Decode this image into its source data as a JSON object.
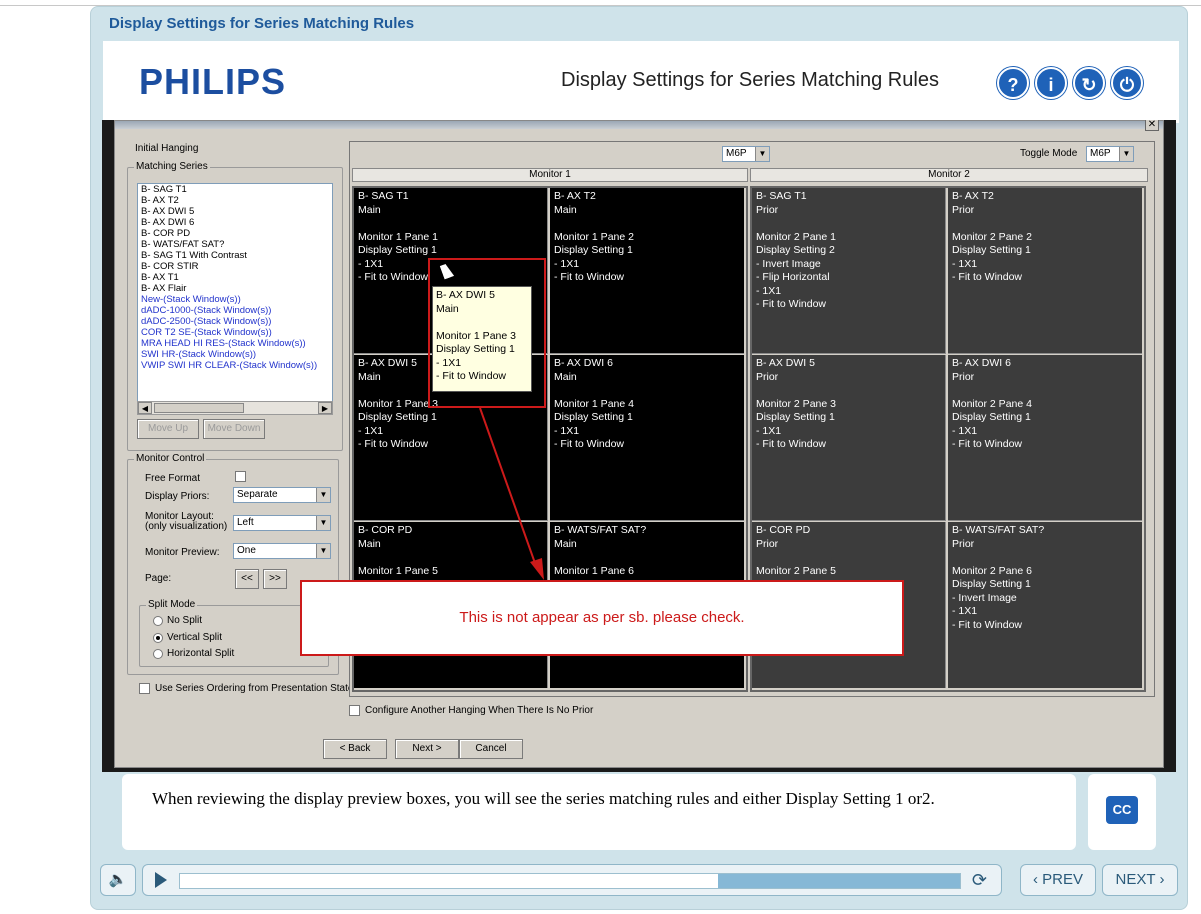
{
  "window_title": "Display Settings for Series Matching Rules",
  "header": {
    "logo": "PHILIPS",
    "title": "Display Settings for Series Matching Rules",
    "buttons": [
      {
        "icon": "help-icon",
        "glyph": "?"
      },
      {
        "icon": "info-icon",
        "glyph": "i"
      },
      {
        "icon": "replay-icon",
        "glyph": "↻"
      },
      {
        "icon": "power-icon",
        "glyph": "⏻"
      }
    ]
  },
  "dialog": {
    "initial_hanging_label": "Initial Hanging",
    "matching_series_label": "Matching Series",
    "series": [
      {
        "text": "B- SAG T1",
        "link": false
      },
      {
        "text": "B- AX T2",
        "link": false
      },
      {
        "text": "B- AX DWI 5",
        "link": false
      },
      {
        "text": "B- AX DWI 6",
        "link": false
      },
      {
        "text": "B- COR PD",
        "link": false
      },
      {
        "text": "B- WATS/FAT SAT?",
        "link": false
      },
      {
        "text": "B- SAG T1 With Contrast",
        "link": false
      },
      {
        "text": "B- COR STIR",
        "link": false
      },
      {
        "text": "B- AX T1",
        "link": false
      },
      {
        "text": "B- AX Flair",
        "link": false
      },
      {
        "text": "New-(Stack Window(s))",
        "link": true
      },
      {
        "text": "dADC-1000-(Stack Window(s))",
        "link": true
      },
      {
        "text": "dADC-2500-(Stack Window(s))",
        "link": true
      },
      {
        "text": "COR T2 SE-(Stack Window(s))",
        "link": true
      },
      {
        "text": "MRA HEAD HI RES-(Stack Window(s))",
        "link": true
      },
      {
        "text": "SWI HR-(Stack Window(s))",
        "link": true
      },
      {
        "text": "VWIP SWI HR CLEAR-(Stack Window(s))",
        "link": true
      }
    ],
    "move_up": "Move Up",
    "move_down": "Move Down",
    "monitor_control_label": "Monitor Control",
    "free_format_label": "Free Format",
    "display_priors_label": "Display Priors:",
    "display_priors_value": "Separate",
    "monitor_layout_label": "Monitor Layout:",
    "monitor_layout_sub": "(only visualization)",
    "monitor_layout_value": "Left",
    "monitor_preview_label": "Monitor Preview:",
    "monitor_preview_value": "One",
    "page_label": "Page:",
    "page_prev": "<<",
    "page_next": ">>",
    "split_mode_label": "Split Mode",
    "split_options": [
      "No Split",
      "Vertical Split",
      "Horizontal Split"
    ],
    "split_selected": "Vertical Split",
    "use_series_ordering": "Use Series Ordering from Presentation State",
    "top_combo_value": "M6P",
    "toggle_mode_label": "Toggle Mode",
    "toggle_mode_value": "M6P",
    "monitor1_label": "Monitor 1",
    "monitor2_label": "Monitor 2",
    "configure_another": "Configure Another Hanging When There Is No Prior",
    "back": "< Back",
    "next": "Next >",
    "cancel": "Cancel"
  },
  "monitor1_panes": [
    "B- SAG T1\nMain\n\nMonitor 1 Pane 1\nDisplay Setting 1\n- 1X1\n- Fit to Window",
    "B- AX T2\nMain\n\nMonitor 1 Pane 2\nDisplay Setting 1\n- 1X1\n- Fit to Window",
    "B- AX DWI 5\nMain\n\nMonitor 1 Pane 3\nDisplay Setting 1\n- 1X1\n- Fit to Window",
    "B- AX DWI 6\nMain\n\nMonitor 1 Pane 4\nDisplay Setting 1\n- 1X1\n- Fit to Window",
    "B- COR PD\nMain\n\nMonitor 1 Pane 5",
    "B- WATS/FAT SAT?\nMain\n\nMonitor 1 Pane 6"
  ],
  "monitor2_panes": [
    "B- SAG T1\nPrior\n\nMonitor 2 Pane 1\nDisplay Setting 2\n- Invert Image\n- Flip Horizontal\n- 1X1\n- Fit to Window",
    "B- AX T2\nPrior\n\nMonitor 2 Pane 2\nDisplay Setting 1\n- 1X1\n- Fit to Window",
    "B- AX DWI 5\nPrior\n\nMonitor 2 Pane 3\nDisplay Setting 1\n- 1X1\n- Fit to Window",
    "B- AX DWI 6\nPrior\n\nMonitor 2 Pane 4\nDisplay Setting 1\n- 1X1\n- Fit to Window",
    "B- COR PD\nPrior\n\nMonitor 2 Pane 5",
    "B- WATS/FAT SAT?\nPrior\n\nMonitor 2 Pane 6\nDisplay Setting 1\n- Invert Image\n- 1X1\n- Fit to Window"
  ],
  "tooltip": "B- AX DWI 5\nMain\n\nMonitor 1 Pane 3\nDisplay Setting 1\n- 1X1\n- Fit to Window",
  "annotation": "This is not appear as per sb. please check.",
  "caption": "When reviewing the display preview boxes, you will see the series matching rules and either Display Setting 1 or2.",
  "cc_label": "CC",
  "controls": {
    "prev": "‹ PREV",
    "next": "NEXT ›",
    "progress_remaining_fraction": 0.31
  },
  "colors": {
    "brand": "#1c4ea0",
    "accent": "#1f62b8",
    "annotation": "#cc1a1a"
  }
}
